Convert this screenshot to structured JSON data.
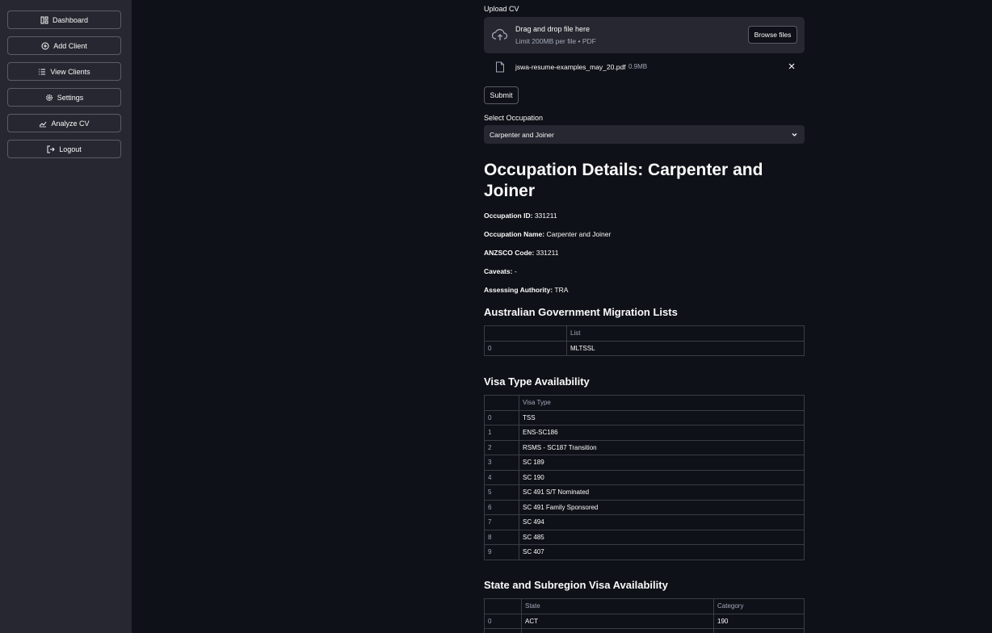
{
  "sidebar": {
    "items": [
      {
        "label": "Dashboard",
        "icon": "dashboard-icon"
      },
      {
        "label": "Add Client",
        "icon": "add-circle-icon"
      },
      {
        "label": "View Clients",
        "icon": "list-icon"
      },
      {
        "label": "Settings",
        "icon": "gear-icon"
      },
      {
        "label": "Analyze CV",
        "icon": "analytics-icon"
      },
      {
        "label": "Logout",
        "icon": "logout-icon"
      }
    ]
  },
  "upload": {
    "label": "Upload CV",
    "drop_title": "Drag and drop file here",
    "drop_sub": "Limit 200MB per file • PDF",
    "browse_label": "Browse files",
    "file_name": "jswa-resume-examples_may_20.pdf",
    "file_size": "0.9MB"
  },
  "submit_label": "Submit",
  "occupation_select": {
    "label": "Select Occupation",
    "value": "Carpenter and Joiner"
  },
  "details": {
    "title": "Occupation Details: Carpenter and Joiner",
    "fields": [
      {
        "key": "Occupation ID:",
        "value": "331211"
      },
      {
        "key": "Occupation Name:",
        "value": "Carpenter and Joiner"
      },
      {
        "key": "ANZSCO Code:",
        "value": "331211"
      },
      {
        "key": "Caveats:",
        "value": "-"
      },
      {
        "key": "Assessing Authority:",
        "value": "TRA"
      }
    ]
  },
  "migration_lists": {
    "heading": "Australian Government Migration Lists",
    "columns": [
      "",
      "List"
    ],
    "rows": [
      [
        "0",
        "MLTSSL"
      ]
    ]
  },
  "visa_types": {
    "heading": "Visa Type Availability",
    "columns": [
      "",
      "Visa Type"
    ],
    "rows": [
      [
        "0",
        "TSS"
      ],
      [
        "1",
        "ENS-SC186"
      ],
      [
        "2",
        "RSMS - SC187 Transition"
      ],
      [
        "3",
        "SC 189"
      ],
      [
        "4",
        "SC 190"
      ],
      [
        "5",
        "SC 491 S/T Nominated"
      ],
      [
        "6",
        "SC 491 Family Sponsored"
      ],
      [
        "7",
        "SC 494"
      ],
      [
        "8",
        "SC 485"
      ],
      [
        "9",
        "SC 407"
      ]
    ]
  },
  "state_visa": {
    "heading": "State and Subregion Visa Availability",
    "columns": [
      "",
      "State",
      "Category"
    ],
    "rows": [
      [
        "0",
        "ACT",
        "190"
      ],
      [
        "",
        "",
        ""
      ]
    ]
  },
  "colors": {
    "background": "#0e1117",
    "sidebar": "#262730",
    "text": "#fafafa",
    "muted": "#a3a8b8"
  }
}
